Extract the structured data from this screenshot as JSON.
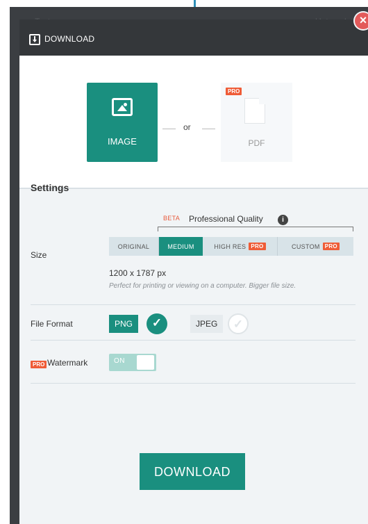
{
  "background": {
    "left_text": "Text",
    "right_text": "Untranslate"
  },
  "modal": {
    "title": "DOWNLOAD",
    "close_icon": "×"
  },
  "choices": {
    "image_label": "IMAGE",
    "or_text": "or",
    "pdf_label": "PDF",
    "pro_badge": "PRO"
  },
  "settings": {
    "title": "Settings",
    "size_label": "Size",
    "beta": "BETA",
    "quality": "Professional Quality",
    "info_icon": "i",
    "size_tabs": [
      {
        "label": "ORIGINAL",
        "pro": ""
      },
      {
        "label": "MEDIUM",
        "pro": ""
      },
      {
        "label": "HIGH RES",
        "pro": "PRO"
      },
      {
        "label": "CUSTOM",
        "pro": "PRO"
      }
    ],
    "resolution": "1200 x 1787 px",
    "note": "Perfect for printing or viewing on a computer. Bigger file size.",
    "file_format_label": "File Format",
    "formats": [
      "PNG",
      "JPEG"
    ],
    "selected_format": "PNG",
    "watermark_label": "Watermark",
    "watermark_toggle": "ON"
  },
  "actions": {
    "download_label": "DOWNLOAD"
  },
  "colors": {
    "accent": "#1a8f7f",
    "pro": "#ef5c37",
    "header": "#34373a",
    "close": "#e35a5a"
  },
  "icons": {
    "arrow": "arrow-down-icon",
    "header": "download-icon",
    "image": "image-icon",
    "pdf": "pdf-icon",
    "info": "info-icon",
    "check": "checkmark-icon"
  }
}
